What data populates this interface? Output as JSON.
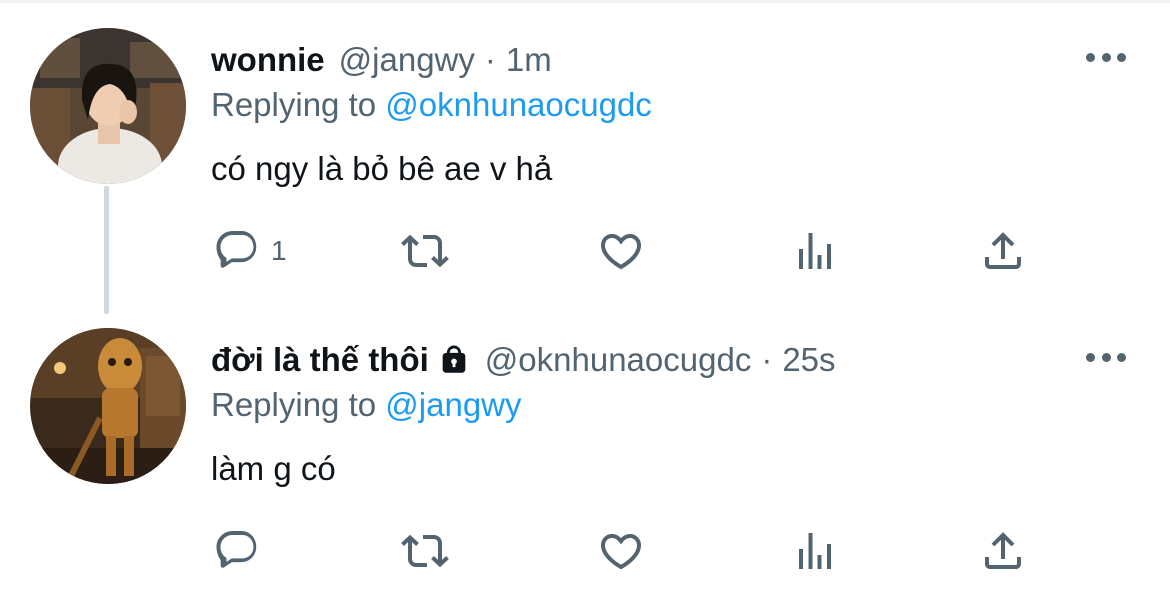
{
  "tweets": [
    {
      "name": "wonnie",
      "handle": "@jangwy",
      "separator": "·",
      "time": "1m",
      "replying_prefix": "Replying to",
      "replying_to": "@oknhunaocugdc",
      "text": "có ngy là bỏ bê ae v hả",
      "reply_count": "1",
      "protected": false
    },
    {
      "name": "đời là thế thôi",
      "handle": "@oknhunaocugdc",
      "separator": "·",
      "time": "25s",
      "replying_prefix": "Replying to",
      "replying_to": "@jangwy",
      "text": "làm g có",
      "reply_count": "",
      "protected": true
    }
  ],
  "colors": {
    "link": "#1d9bf0",
    "secondary_text": "#536471",
    "primary_text": "#0f1419",
    "thread_line": "#cfd9de"
  },
  "icons": [
    "reply-icon",
    "retweet-icon",
    "like-icon",
    "stats-icon",
    "share-icon",
    "more-icon",
    "lock-icon"
  ]
}
